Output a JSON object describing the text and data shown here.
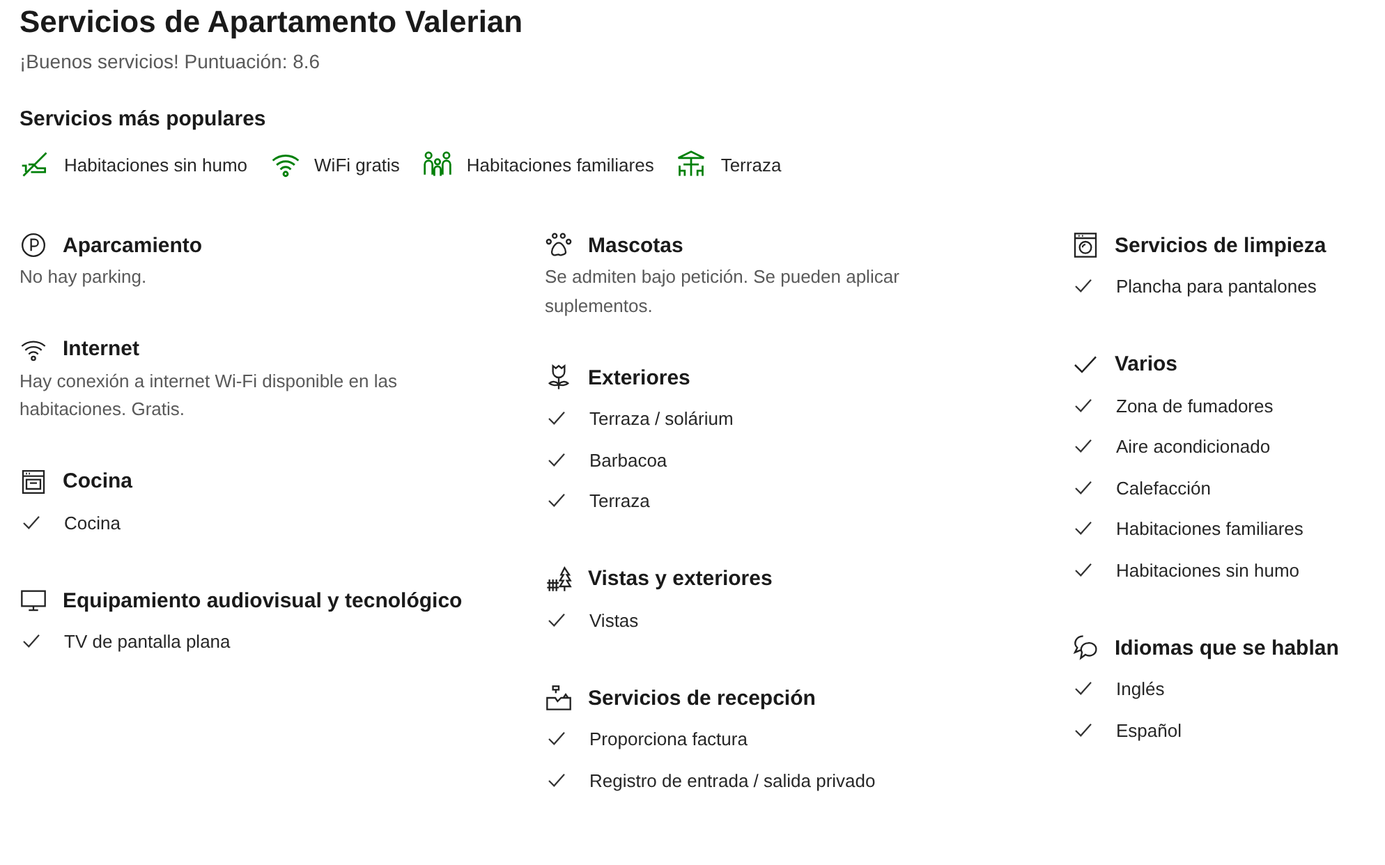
{
  "title": "Servicios de Apartamento Valerian",
  "subtitle": "¡Buenos servicios! Puntuación: 8.6",
  "popular": {
    "heading": "Servicios más populares",
    "items": [
      "Habitaciones sin humo",
      "WiFi gratis",
      "Habitaciones familiares",
      "Terraza"
    ]
  },
  "columns": [
    {
      "groups": [
        {
          "heading": "Aparcamiento",
          "kind": "text",
          "text": "No hay parking."
        },
        {
          "heading": "Internet",
          "kind": "text",
          "text": "Hay conexión a internet Wi-Fi disponible en las habitaciones. Gratis."
        },
        {
          "heading": "Cocina",
          "kind": "list",
          "items": [
            "Cocina"
          ]
        },
        {
          "heading": "Equipamiento audiovisual y tecnológico",
          "kind": "list",
          "items": [
            "TV de pantalla plana"
          ]
        }
      ]
    },
    {
      "groups": [
        {
          "heading": "Mascotas",
          "kind": "text",
          "text": "Se admiten bajo petición. Se pueden aplicar suplementos."
        },
        {
          "heading": "Exteriores",
          "kind": "list",
          "items": [
            "Terraza / solárium",
            "Barbacoa",
            "Terraza"
          ]
        },
        {
          "heading": "Vistas y exteriores",
          "kind": "list",
          "items": [
            "Vistas"
          ]
        },
        {
          "heading": "Servicios de recepción",
          "kind": "list",
          "items": [
            "Proporciona factura",
            "Registro de entrada / salida privado"
          ]
        }
      ]
    },
    {
      "groups": [
        {
          "heading": "Servicios de limpieza",
          "kind": "list",
          "items": [
            "Plancha para pantalones"
          ]
        },
        {
          "heading": "Varios",
          "kind": "list",
          "items": [
            "Zona de fumadores",
            "Aire acondicionado",
            "Calefacción",
            "Habitaciones familiares",
            "Habitaciones sin humo"
          ]
        },
        {
          "heading": "Idiomas que se hablan",
          "kind": "list",
          "items": [
            "Inglés",
            "Español"
          ]
        }
      ]
    }
  ]
}
